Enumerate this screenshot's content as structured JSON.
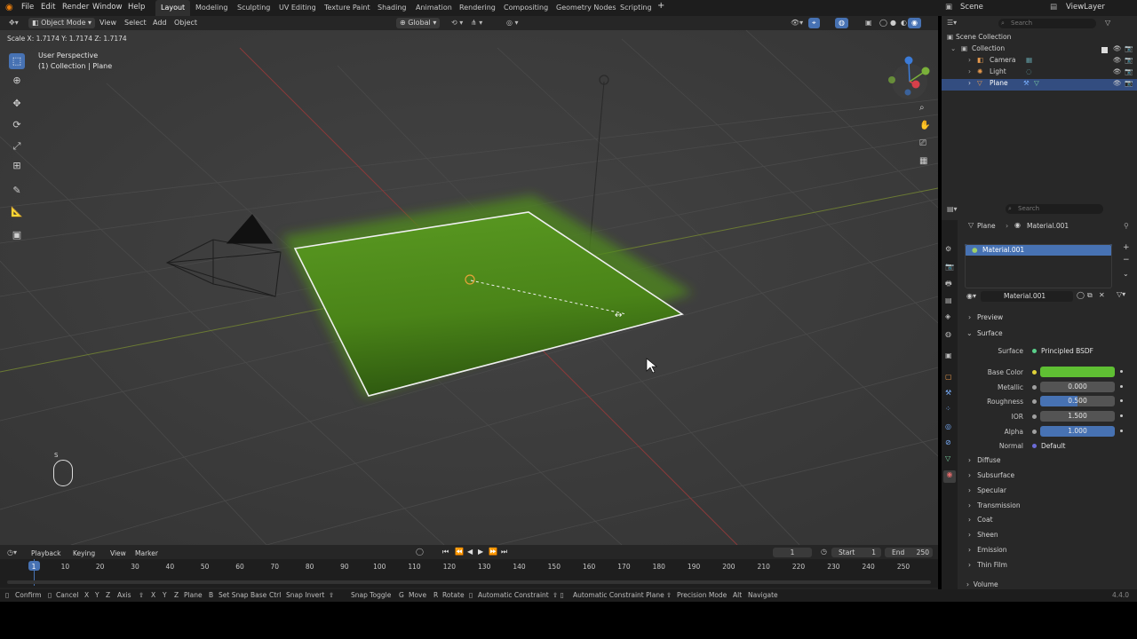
{
  "topbar": {
    "menus": [
      "File",
      "Edit",
      "Render",
      "Window",
      "Help"
    ],
    "workspaces": [
      "Layout",
      "Modeling",
      "Sculpting",
      "UV Editing",
      "Texture Paint",
      "Shading",
      "Animation",
      "Rendering",
      "Compositing",
      "Geometry Nodes",
      "Scripting"
    ],
    "active_workspace": "Layout",
    "scene": "Scene",
    "view_layer": "ViewLayer"
  },
  "viewport_header": {
    "mode": "Object Mode",
    "menus": [
      "View",
      "Select",
      "Add",
      "Object"
    ],
    "transform_orientation": "Global"
  },
  "viewport": {
    "operator_status": "Scale X: 1.7174   Y: 1.7174   Z: 1.7174",
    "view_name": "User Perspective",
    "collection_info": "(1) Collection | Plane",
    "key_hint": "S"
  },
  "outliner": {
    "search_placeholder": "Search",
    "items": [
      {
        "label": "Scene Collection"
      },
      {
        "label": "Collection"
      },
      {
        "label": "Camera"
      },
      {
        "label": "Light"
      },
      {
        "label": "Plane"
      }
    ]
  },
  "properties": {
    "search_placeholder": "Search",
    "breadcrumb_object": "Plane",
    "breadcrumb_material": "Material.001",
    "slot_material": "Material.001",
    "material_name": "Material.001",
    "panels": {
      "preview": "Preview",
      "surface": "Surface"
    },
    "surface_shader_label": "Surface",
    "surface_shader": "Principled BSDF",
    "fields": [
      {
        "label": "Base Color",
        "value": "",
        "color": "#5fbf33"
      },
      {
        "label": "Metallic",
        "value": "0.000"
      },
      {
        "label": "Roughness",
        "value": "0.500",
        "fill": 0.5
      },
      {
        "label": "IOR",
        "value": "1.500"
      },
      {
        "label": "Alpha",
        "value": "1.000",
        "fill": 1.0
      },
      {
        "label": "Normal",
        "value": "Default"
      }
    ],
    "subpanels": [
      "Diffuse",
      "Subsurface",
      "Specular",
      "Transmission",
      "Coat",
      "Sheen",
      "Emission",
      "Thin Film"
    ],
    "volume": "Volume"
  },
  "timeline": {
    "menus": [
      "Playback",
      "Keying",
      "View",
      "Marker"
    ],
    "current_frame": "1",
    "start_label": "Start",
    "start_value": "1",
    "end_label": "End",
    "end_value": "250",
    "ruler": [
      "1",
      "10",
      "20",
      "30",
      "40",
      "50",
      "60",
      "70",
      "80",
      "90",
      "100",
      "110",
      "120",
      "130",
      "140",
      "150",
      "160",
      "170",
      "180",
      "190",
      "200",
      "210",
      "220",
      "230",
      "240",
      "250"
    ]
  },
  "statusbar": {
    "hints": [
      "Confirm",
      "Cancel",
      "X",
      "Y",
      "Z",
      "Axis",
      "X",
      "Y",
      "Z",
      "Plane",
      "B",
      "Set Snap Base",
      "Ctrl",
      "Snap Invert",
      "Snap Toggle",
      "G",
      "Move",
      "R",
      "Rotate",
      "Automatic Constraint",
      "Automatic Constraint Plane",
      "Precision Mode",
      "Alt",
      "Navigate"
    ],
    "version": "4.4.0"
  },
  "colors": {
    "accent": "#4772b3",
    "grass": "#4f8a1e",
    "viewport_bg": "#3d3d3d"
  }
}
